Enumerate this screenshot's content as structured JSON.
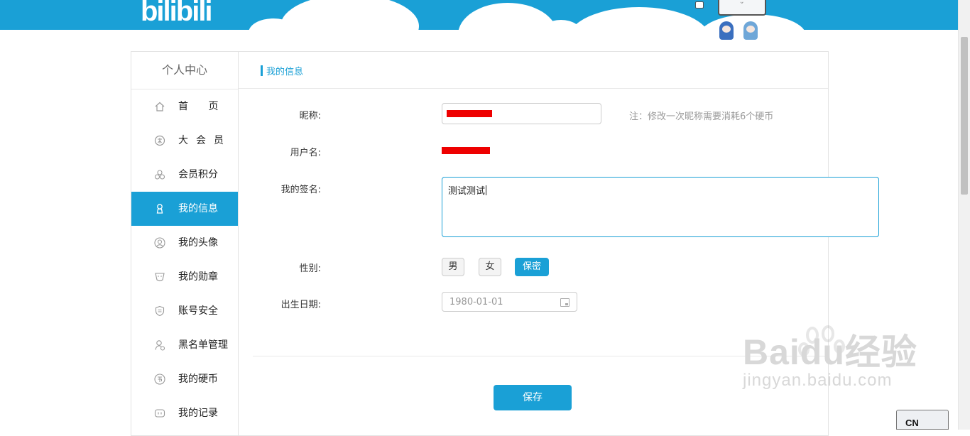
{
  "banner": {
    "logo_text": "bilibili",
    "mascot_face": "ᵕ"
  },
  "sidebar": {
    "title": "个人中心",
    "items": [
      {
        "label": "首 页",
        "icon": "home-icon"
      },
      {
        "label": "大会员",
        "icon": "vip-icon"
      },
      {
        "label": "会员积分",
        "icon": "points-icon"
      },
      {
        "label": "我的信息",
        "icon": "user-icon",
        "active": true
      },
      {
        "label": "我的头像",
        "icon": "avatar-icon"
      },
      {
        "label": "我的勋章",
        "icon": "medal-icon"
      },
      {
        "label": "账号安全",
        "icon": "shield-icon"
      },
      {
        "label": "黑名单管理",
        "icon": "blacklist-icon"
      },
      {
        "label": "我的硬币",
        "icon": "coin-icon"
      },
      {
        "label": "我的记录",
        "icon": "record-icon"
      }
    ]
  },
  "main": {
    "header_title": "我的信息",
    "nickname_label": "昵称:",
    "nickname_note": "注：修改一次昵称需要消耗6个硬币",
    "username_label": "用户名:",
    "signature_label": "我的签名:",
    "signature_value": "测试测试",
    "gender_label": "性别:",
    "gender_options": [
      "男",
      "女",
      "保密"
    ],
    "gender_selected": "保密",
    "birthday_label": "出生日期:",
    "birthday_value": "1980-01-01",
    "save_label": "保存"
  },
  "watermark": {
    "main": "Baidu经验",
    "sub": "jingyan.baidu.com"
  },
  "ime": {
    "label": "CN"
  },
  "colors": {
    "accent": "#1aa0d6",
    "redaction": "#ee0000"
  }
}
